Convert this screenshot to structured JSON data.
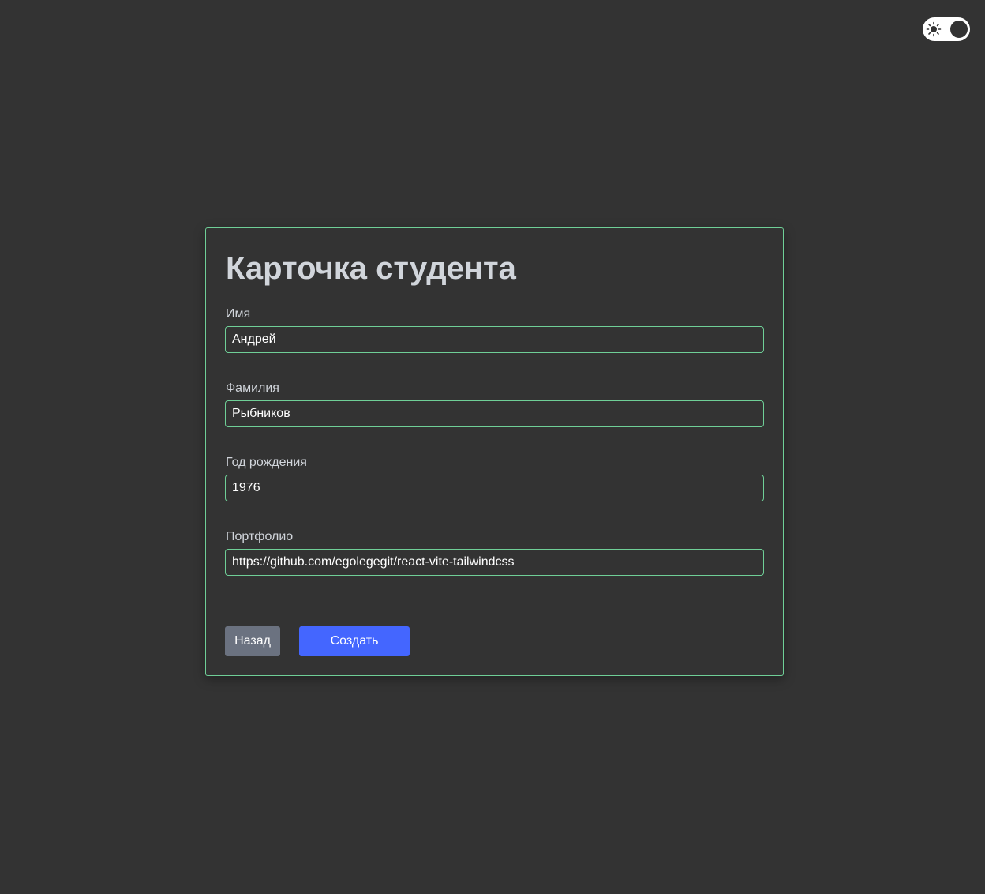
{
  "theme_toggle": {
    "icon": "sun-icon",
    "state": "dark"
  },
  "card": {
    "title": "Карточка студента",
    "fields": [
      {
        "label": "Имя",
        "value": "Андрей"
      },
      {
        "label": "Фамилия",
        "value": "Рыбников"
      },
      {
        "label": "Год рождения",
        "value": "1976"
      },
      {
        "label": "Портфолио",
        "value": "https://github.com/egolegegit/react-vite-tailwindcss"
      }
    ],
    "back_label": "Назад",
    "create_label": "Создать"
  },
  "colors": {
    "background": "#333333",
    "accent_border": "#6fcf97",
    "primary_button": "#4466ff",
    "secondary_button": "#6b7280"
  }
}
